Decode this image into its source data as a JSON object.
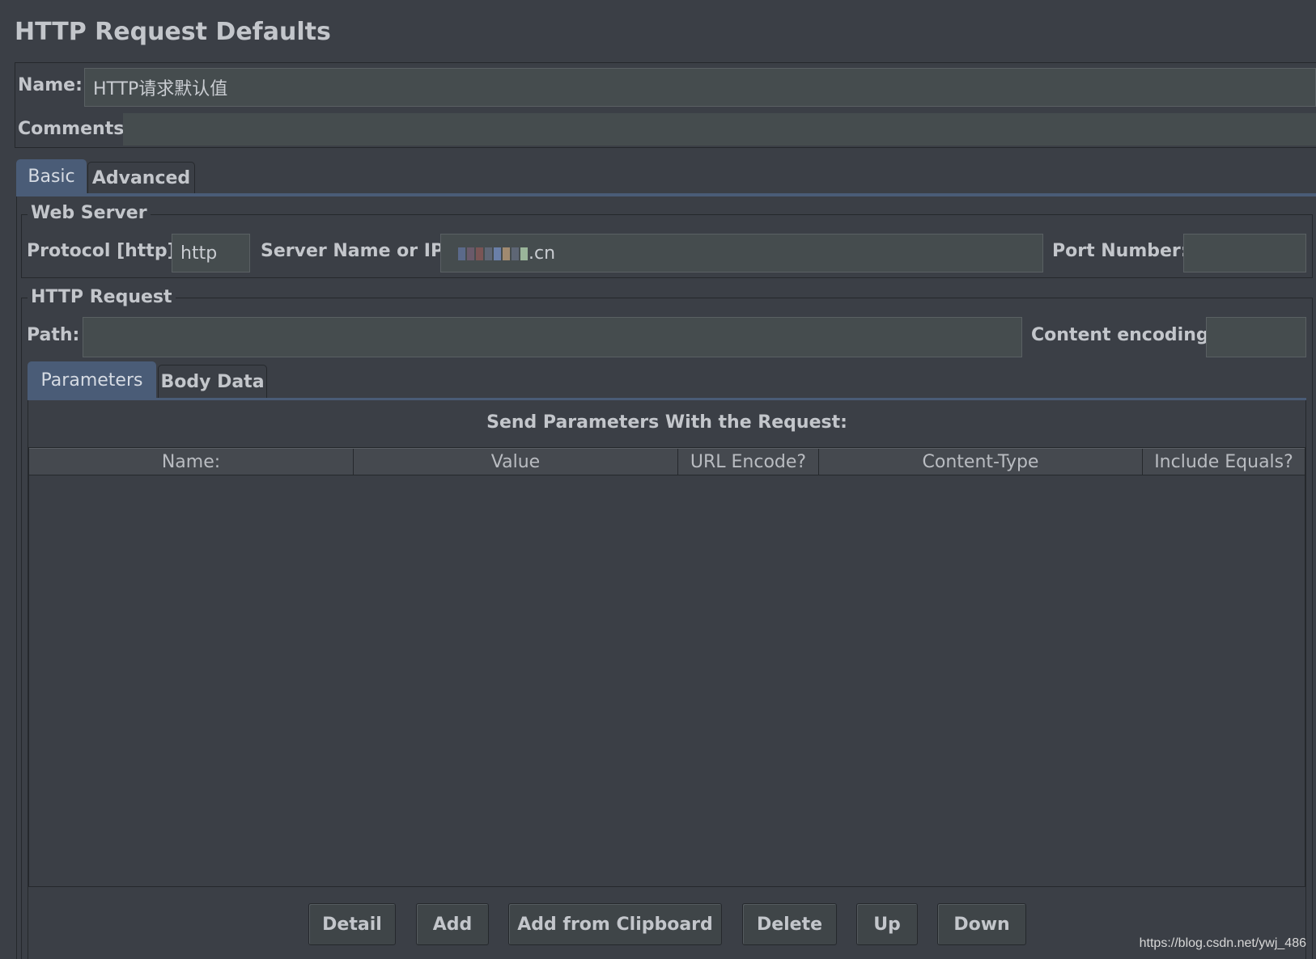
{
  "window": {
    "title": "HTTP Request Defaults"
  },
  "form": {
    "name_label": "Name:",
    "name_value": "HTTP请求默认值",
    "comments_label": "Comments:",
    "comments_value": ""
  },
  "tabs": [
    {
      "label": "Basic",
      "active": true
    },
    {
      "label": "Advanced",
      "active": false
    }
  ],
  "web_server": {
    "legend": "Web Server",
    "protocol_label": "Protocol [http]:",
    "protocol_value": "http",
    "server_label": "Server Name or IP:",
    "server_value_suffix": ".cn",
    "port_label": "Port Number:",
    "port_value": ""
  },
  "http_request": {
    "legend": "HTTP Request",
    "path_label": "Path:",
    "path_value": "",
    "encoding_label": "Content encoding:",
    "encoding_value": ""
  },
  "param_tabs": [
    {
      "label": "Parameters",
      "active": true
    },
    {
      "label": "Body Data",
      "active": false
    }
  ],
  "parameters": {
    "heading": "Send Parameters With the Request:",
    "columns": [
      "Name:",
      "Value",
      "URL Encode?",
      "Content-Type",
      "Include Equals?"
    ],
    "rows": []
  },
  "buttons": {
    "detail": "Detail",
    "add": "Add",
    "add_clipboard": "Add from Clipboard",
    "delete": "Delete",
    "up": "Up",
    "down": "Down"
  },
  "watermark": "https://blog.csdn.net/ywj_486",
  "colors": {
    "background": "#3b3f46",
    "field": "#454c4e",
    "active_tab": "#4a5c77"
  }
}
